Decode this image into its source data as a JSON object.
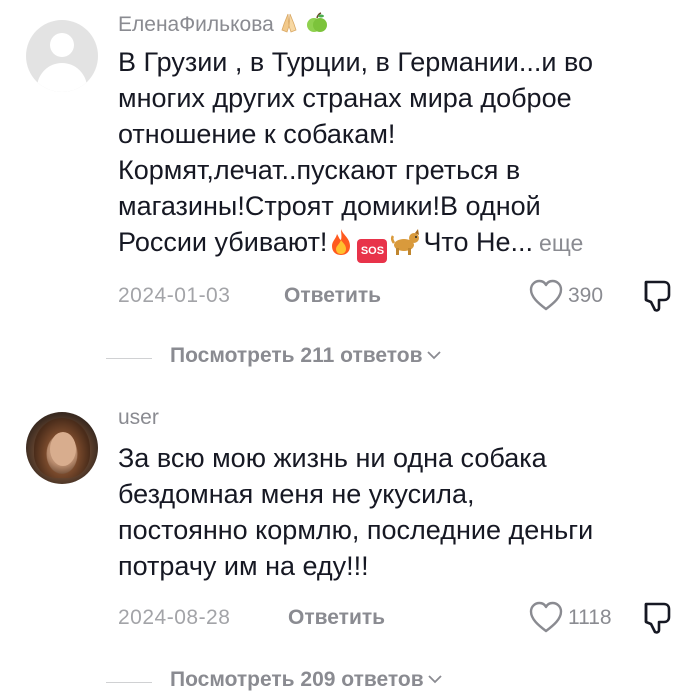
{
  "comments": [
    {
      "username": "ЕленаФилькова",
      "username_emojis": [
        "folded-hands-emoji",
        "green-apple-emoji"
      ],
      "lines": [
        "В Грузии , в Турции, в Германии...и во",
        "многих других странах мира доброе",
        "отношение к собакам!",
        "Кормят,лечат..пускают греться в",
        "магазины!Строят домики!В одной"
      ],
      "last_line_before": "России убивают!",
      "last_line_after": "Что Не...",
      "inline_emojis": [
        "fire-emoji",
        "sos-emoji",
        "dog-emoji"
      ],
      "sos_label": "SOS",
      "more_label": "еще",
      "date": "2024-01-03",
      "reply_label": "Ответить",
      "likes": "390",
      "view_replies": "Посмотреть 211 ответов"
    },
    {
      "username": "user",
      "lines": [
        "За всю мою жизнь ни одна собака",
        "бездомная меня не укусила,",
        "постоянно кормлю, последние деньги",
        "потрачу им на еду!!!"
      ],
      "date": "2024-08-28",
      "reply_label": "Ответить",
      "likes": "1118",
      "view_replies": "Посмотреть 209 ответов"
    }
  ],
  "colors": {
    "text": "#161823",
    "secondary": "#8a8b91",
    "date": "#a3a4a8",
    "divider": "#d0d1d3"
  }
}
